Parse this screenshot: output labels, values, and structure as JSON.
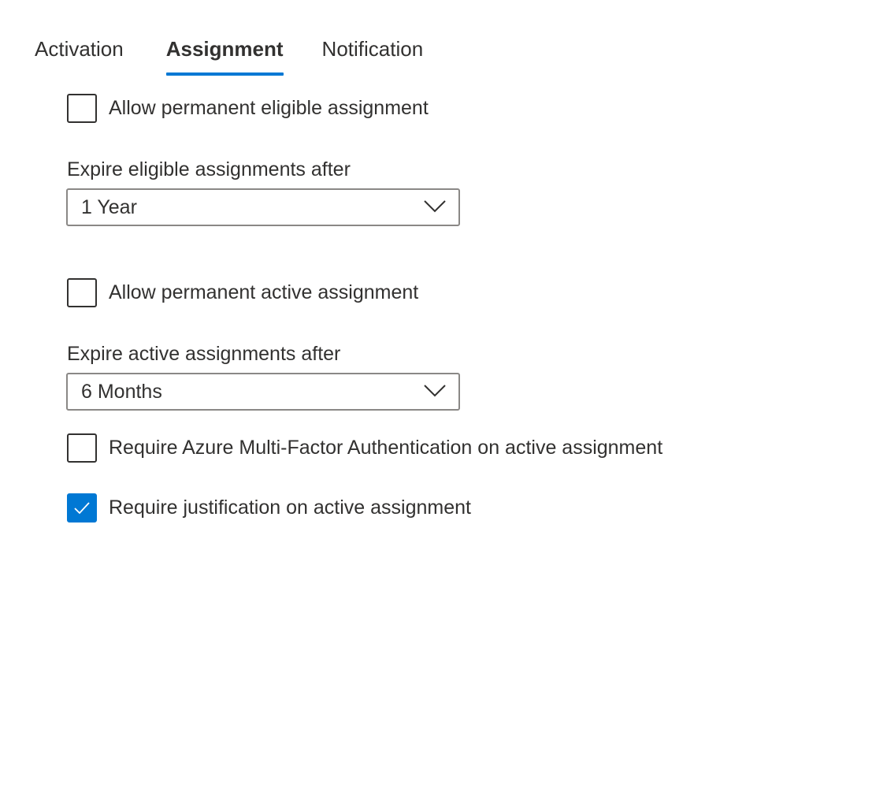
{
  "tabs": [
    {
      "label": "Activation",
      "active": false
    },
    {
      "label": "Assignment",
      "active": true
    },
    {
      "label": "Notification",
      "active": false
    }
  ],
  "assignment": {
    "allow_permanent_eligible": {
      "label": "Allow permanent eligible assignment",
      "checked": false
    },
    "expire_eligible": {
      "label": "Expire eligible assignments after",
      "value": "1 Year"
    },
    "allow_permanent_active": {
      "label": "Allow permanent active assignment",
      "checked": false
    },
    "expire_active": {
      "label": "Expire active assignments after",
      "value": "6 Months"
    },
    "require_mfa": {
      "label": "Require Azure Multi-Factor Authentication on active assignment",
      "checked": false
    },
    "require_justification": {
      "label": "Require justification on active assignment",
      "checked": true
    }
  },
  "icons": {
    "dropdown": "chevron-down-icon",
    "check": "checkmark-icon"
  },
  "colors": {
    "accent": "#0078d4",
    "text": "#323130",
    "border": "#8a8886"
  }
}
